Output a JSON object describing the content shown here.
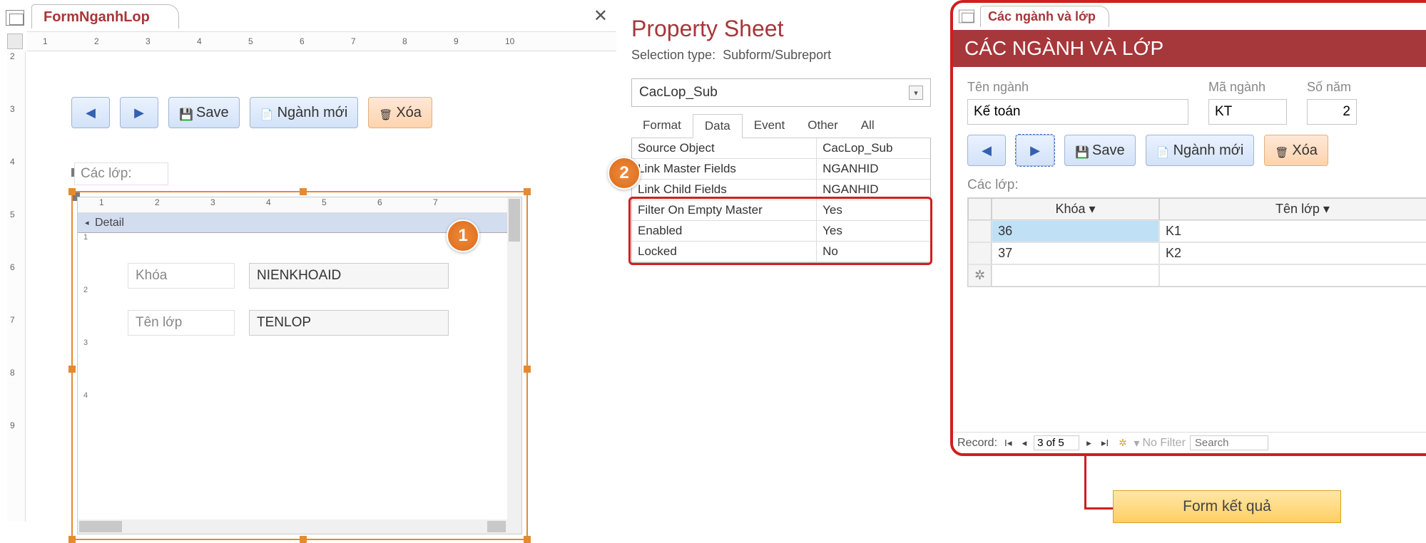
{
  "left": {
    "tab_title": "FormNganhLop",
    "ruler_marks": [
      "1",
      "2",
      "3",
      "4",
      "5",
      "6",
      "7",
      "8",
      "9",
      "10"
    ],
    "vruler_marks": [
      "2",
      "3",
      "4",
      "5",
      "6",
      "7",
      "8",
      "9"
    ],
    "buttons": {
      "prev": "◀",
      "next": "▶",
      "save": "Save",
      "newmajor": "Ngành mới",
      "delete": "Xóa"
    },
    "label_caclop": "Các lớp:",
    "subform": {
      "ruler_marks": [
        "1",
        "2",
        "3",
        "4",
        "5",
        "6",
        "7"
      ],
      "section": "Detail",
      "vruler_marks": [
        "1",
        "2",
        "3",
        "4"
      ],
      "fields": [
        {
          "label": "Khóa",
          "bound": "NIENKHOAID"
        },
        {
          "label": "Tên lớp",
          "bound": "TENLOP"
        }
      ]
    }
  },
  "callouts": {
    "one": "1",
    "two": "2"
  },
  "property_sheet": {
    "title": "Property Sheet",
    "selection_label": "Selection type:",
    "selection_value": "Subform/Subreport",
    "combo_value": "CacLop_Sub",
    "tabs": [
      "Format",
      "Data",
      "Event",
      "Other",
      "All"
    ],
    "active_tab": "Data",
    "rows": [
      {
        "name": "Source Object",
        "value": "CacLop_Sub"
      },
      {
        "name": "Link Master Fields",
        "value": "NGANHID"
      },
      {
        "name": "Link Child Fields",
        "value": "NGANHID"
      },
      {
        "name": "Filter On Empty Master",
        "value": "Yes"
      },
      {
        "name": "Enabled",
        "value": "Yes"
      },
      {
        "name": "Locked",
        "value": "No"
      }
    ]
  },
  "right": {
    "tab_title": "Các ngành và lớp",
    "header": "CÁC NGÀNH VÀ LỚP",
    "fields": {
      "tennganh_label": "Tên ngành",
      "tennganh_value": "Kế toán",
      "manganh_label": "Mã ngành",
      "manganh_value": "KT",
      "sonam_label": "Số năm",
      "sonam_value": "2"
    },
    "buttons": {
      "prev": "◀",
      "next": "▶",
      "save": "Save",
      "newmajor": "Ngành mới",
      "delete": "Xóa"
    },
    "section_label": "Các lớp:",
    "datasheet": {
      "headers": [
        "Khóa",
        "Tên lớp"
      ],
      "rows": [
        {
          "khoa": "36",
          "tenlop": "K1"
        },
        {
          "khoa": "37",
          "tenlop": "K2"
        }
      ]
    },
    "nav": {
      "label": "Record:",
      "pos": "3 of 5",
      "nofilter": "No Filter",
      "search": "Search"
    }
  },
  "result_label": "Form kết quả"
}
